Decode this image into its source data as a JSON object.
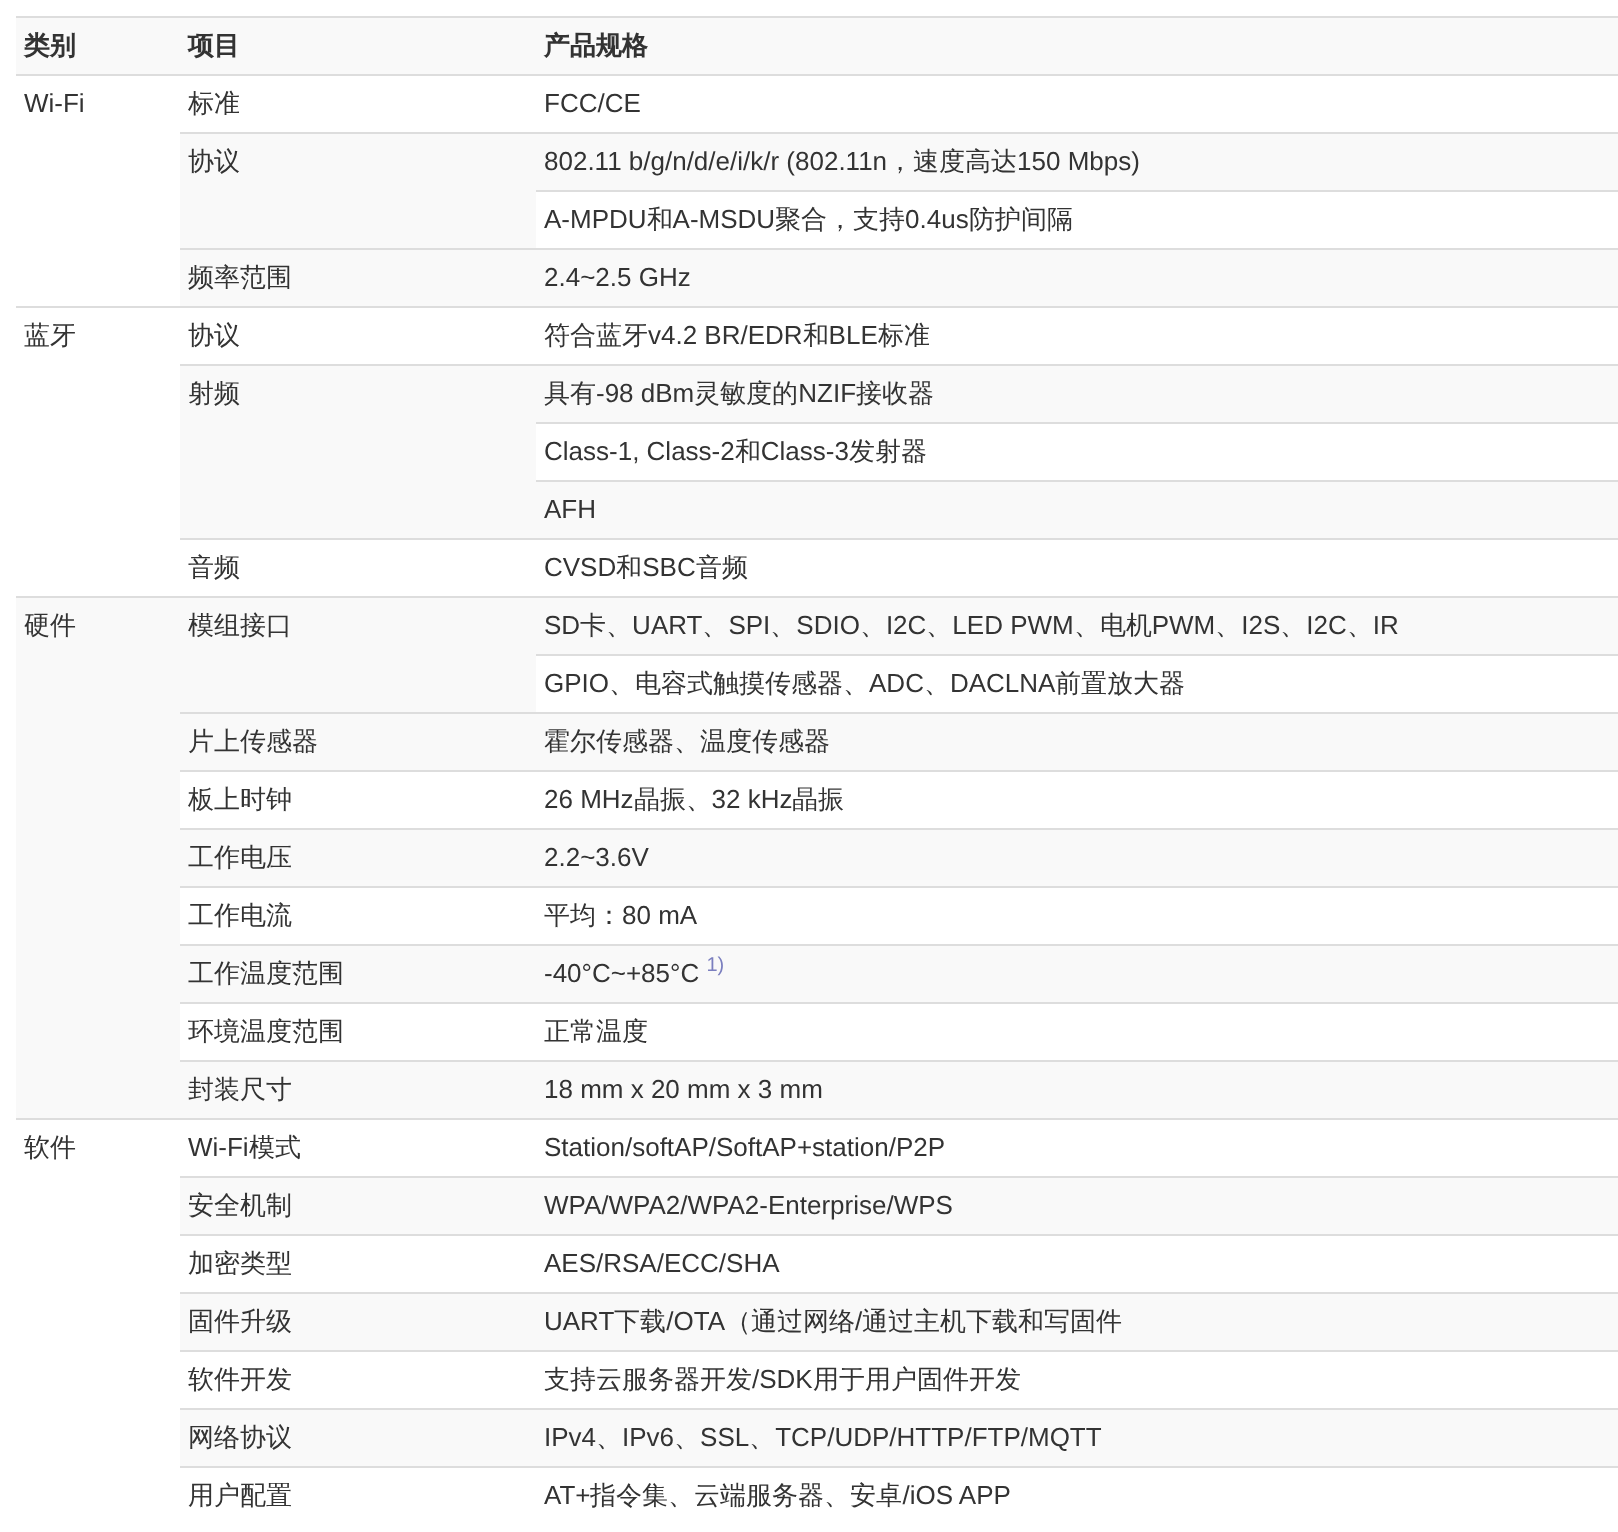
{
  "columns": [
    "类别",
    "项目",
    "产品规格"
  ],
  "groups": [
    {
      "category": "Wi-Fi",
      "items": [
        {
          "item": "标准",
          "specs": [
            "FCC/CE"
          ]
        },
        {
          "item": "协议",
          "specs": [
            "802.11 b/g/n/d/e/i/k/r (802.11n，速度高达150 Mbps)",
            "A-MPDU和A-MSDU聚合，支持0.4us防护间隔"
          ]
        },
        {
          "item": "频率范围",
          "specs": [
            "2.4~2.5 GHz"
          ]
        }
      ]
    },
    {
      "category": "蓝牙",
      "items": [
        {
          "item": "协议",
          "specs": [
            "符合蓝牙v4.2 BR/EDR和BLE标准"
          ]
        },
        {
          "item": "射频",
          "specs": [
            "具有-98 dBm灵敏度的NZIF接收器",
            "Class-1, Class-2和Class-3发射器",
            "AFH"
          ]
        },
        {
          "item": "音频",
          "specs": [
            "CVSD和SBC音频"
          ]
        }
      ]
    },
    {
      "category": "硬件",
      "items": [
        {
          "item": "模组接口",
          "specs": [
            "SD卡、UART、SPI、SDIO、I2C、LED PWM、电机PWM、I2S、I2C、IR",
            "GPIO、电容式触摸传感器、ADC、DACLNA前置放大器"
          ]
        },
        {
          "item": "片上传感器",
          "specs": [
            "霍尔传感器、温度传感器"
          ]
        },
        {
          "item": "板上时钟",
          "specs": [
            "26 MHz晶振、32 kHz晶振"
          ]
        },
        {
          "item": "工作电压",
          "specs": [
            "2.2~3.6V"
          ]
        },
        {
          "item": "工作电流",
          "specs": [
            "平均：80 mA"
          ]
        },
        {
          "item": "工作温度范围",
          "specs": [
            "-40°C~+85°C $^{1)}$"
          ]
        },
        {
          "item": "环境温度范围",
          "specs": [
            "正常温度"
          ]
        },
        {
          "item": "封装尺寸",
          "specs": [
            "18 mm x 20 mm x 3 mm"
          ]
        }
      ]
    },
    {
      "category": "软件",
      "items": [
        {
          "item": "Wi-Fi模式",
          "specs": [
            "Station/softAP/SoftAP+station/P2P"
          ]
        },
        {
          "item": "安全机制",
          "specs": [
            "WPA/WPA2/WPA2-Enterprise/WPS"
          ]
        },
        {
          "item": "加密类型",
          "specs": [
            "AES/RSA/ECC/SHA"
          ]
        },
        {
          "item": "固件升级",
          "specs": [
            "UART下载/OTA（通过网络/通过主机下载和写固件"
          ]
        },
        {
          "item": "软件开发",
          "specs": [
            "支持云服务器开发/SDK用于用户固件开发"
          ]
        },
        {
          "item": "网络协议",
          "specs": [
            "IPv4、IPv6、SSL、TCP/UDP/HTTP/FTP/MQTT"
          ]
        },
        {
          "item": "用户配置",
          "specs": [
            "AT+指令集、云端服务器、安卓/iOS APP"
          ]
        }
      ]
    }
  ]
}
